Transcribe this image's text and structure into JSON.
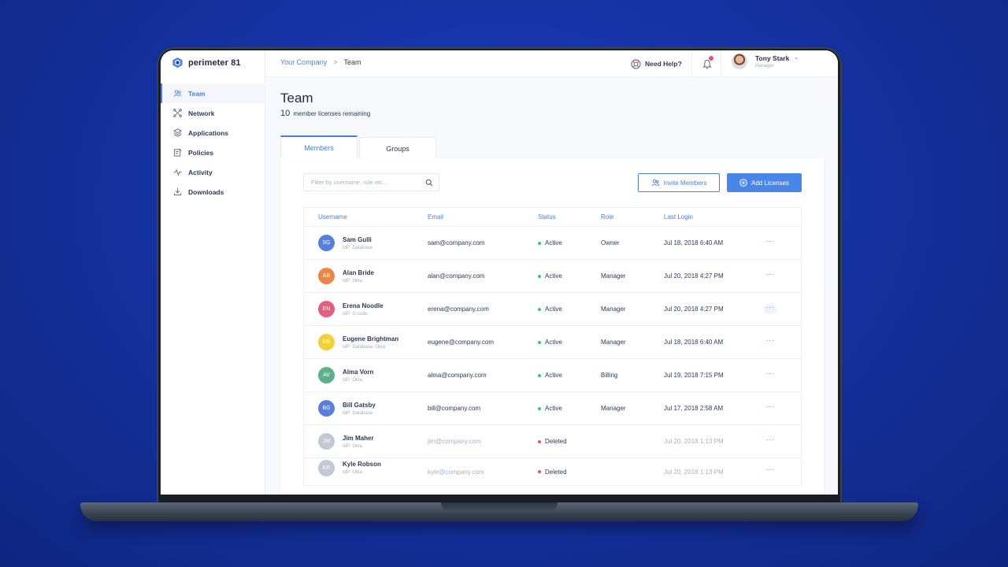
{
  "app": {
    "name": "perimeter 81"
  },
  "colors": {
    "accent": "#4a7ed9",
    "active": "#3fbf8f",
    "deleted": "#e2546f"
  },
  "sidebar": {
    "items": [
      {
        "label": "Team",
        "icon": "team-icon",
        "active": true
      },
      {
        "label": "Network",
        "icon": "network-icon"
      },
      {
        "label": "Applications",
        "icon": "applications-icon"
      },
      {
        "label": "Policies",
        "icon": "policies-icon"
      },
      {
        "label": "Activity",
        "icon": "activity-icon"
      },
      {
        "label": "Downloads",
        "icon": "download-icon"
      }
    ]
  },
  "header": {
    "breadcrumb": [
      "Your Company",
      "Team"
    ],
    "breadcrumb_sep": ">",
    "help_label": "Need Help?",
    "user": {
      "name": "Tony Stark",
      "role": "Manager"
    }
  },
  "page": {
    "title": "Team",
    "license_count": "10",
    "license_text": "member licenses remaining",
    "tabs": [
      "Members",
      "Groups"
    ]
  },
  "toolbar": {
    "filter_placeholder": "Filter by username, role etc...",
    "invite_label": "Invite Members",
    "add_label": "Add Licenses"
  },
  "table": {
    "columns": [
      "Username",
      "Email",
      "Status",
      "Role",
      "Last Login"
    ],
    "rows": [
      {
        "initials": "SG",
        "color": "#5b7fd9",
        "name": "Sam Gulli",
        "idp": "IdP: Database",
        "email": "sam@company.com",
        "status": "Active",
        "role": "Owner",
        "last_login": "Jul 18, 2018 6:40 AM"
      },
      {
        "initials": "AB",
        "color": "#e8874a",
        "name": "Alan Bride",
        "idp": "IdP: Okta",
        "email": "alan@company.com",
        "status": "Active",
        "role": "Manager",
        "last_login": "Jul 20, 2018 4:27 PM"
      },
      {
        "initials": "EN",
        "color": "#e0607e",
        "name": "Erena Noodle",
        "idp": "IdP: G-suite",
        "email": "erena@company.com",
        "status": "Active",
        "role": "Manager",
        "last_login": "Jul 20, 2018 4:27 PM"
      },
      {
        "initials": "EB",
        "color": "#f2cf3c",
        "name": "Eugene Brightman",
        "idp": "IdP: Database, Okta",
        "email": "eugene@company.com",
        "status": "Active",
        "role": "Manager",
        "last_login": "Jul 18, 2018 6:40 AM"
      },
      {
        "initials": "AV",
        "color": "#5fb08a",
        "name": "Alma Vorn",
        "idp": "IdP: Okta",
        "email": "alma@company.com",
        "status": "Active",
        "role": "Billing",
        "last_login": "Jul 19, 2018 7:15 PM"
      },
      {
        "initials": "BG",
        "color": "#5b7fd9",
        "name": "Bill Gatsby",
        "idp": "IdP: Database",
        "email": "bill@company.com",
        "status": "Active",
        "role": "Manager",
        "last_login": "Jul 17, 2018 2:58 AM"
      },
      {
        "initials": "JM",
        "color": "#c3c8d2",
        "name": "Jim Maher",
        "idp": "IdP: Okta",
        "email": "jim@company.com",
        "status": "Deleted",
        "role": "",
        "last_login": "Jul 20, 2018 1:13 PM"
      },
      {
        "initials": "KR",
        "color": "#c3c8d2",
        "name": "Kyle Robson",
        "idp": "IdP: Okta",
        "email": "kyle@company.com",
        "status": "Deleted",
        "role": "",
        "last_login": "Jul 20, 2018 1:13 PM"
      }
    ]
  }
}
